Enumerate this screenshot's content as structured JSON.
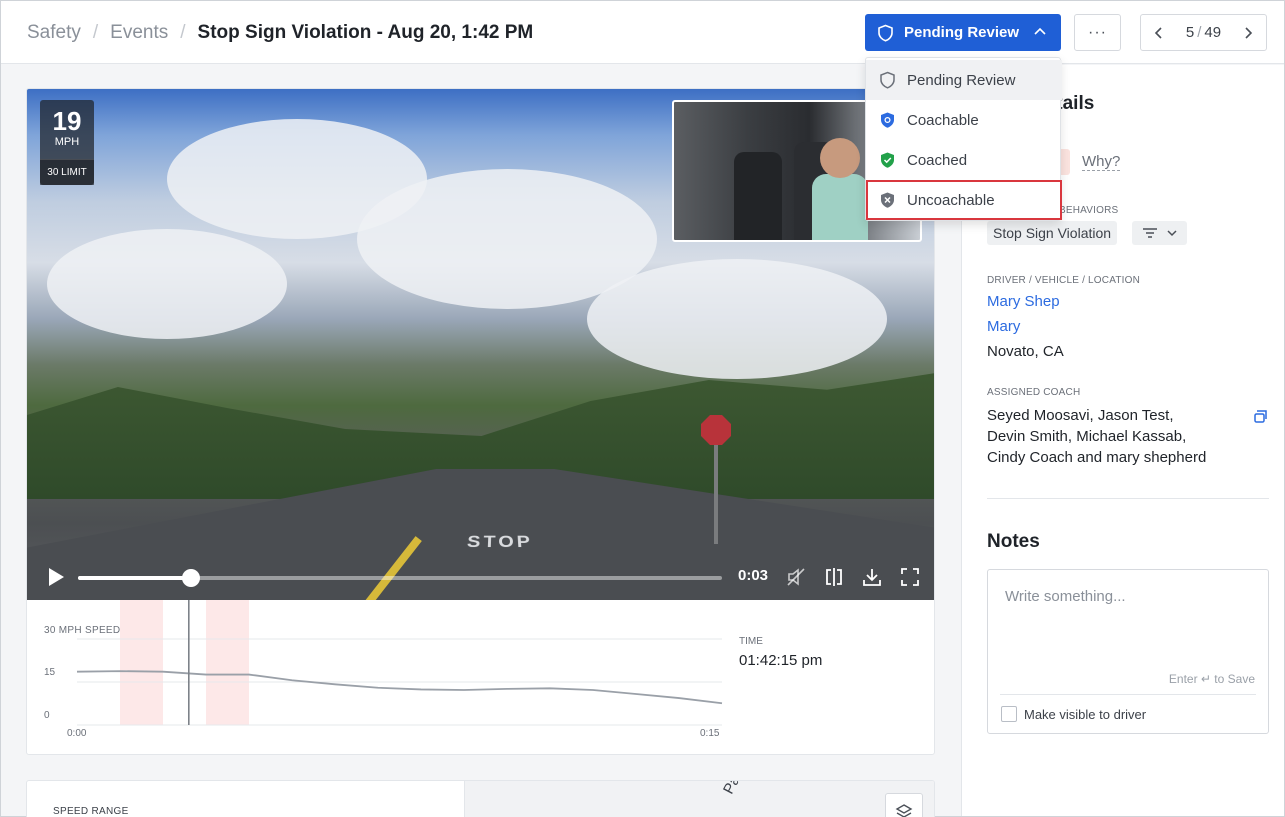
{
  "breadcrumb": {
    "items": [
      "Safety",
      "Events"
    ],
    "current": "Stop Sign Violation - Aug 20, 1:42 PM"
  },
  "status_button": {
    "label": "Pending Review"
  },
  "more_button": {
    "label": "···"
  },
  "pager": {
    "current": "5",
    "total": "49"
  },
  "video": {
    "speed": "19",
    "speed_unit": "MPH",
    "speed_limit": "30 LIMIT",
    "road_text": "STOP",
    "time": "0:03",
    "progress": 0.175
  },
  "speed_chart": {
    "title": "30 MPH SPEED",
    "time_label": "TIME",
    "time_value": "01:42:15 pm"
  },
  "chart_data": {
    "type": "line",
    "title": "30 MPH SPEED",
    "x": [
      0,
      1,
      2,
      3,
      4,
      5,
      6,
      7,
      8,
      9,
      10,
      11,
      12,
      13,
      14,
      15
    ],
    "values": [
      18.6,
      18.8,
      18.6,
      17.6,
      17.6,
      15.6,
      14.2,
      13.0,
      12.4,
      12.2,
      12.6,
      12.8,
      12.2,
      10.8,
      9.4,
      7.6
    ],
    "yticks": [
      "0",
      "15"
    ],
    "xticks": [
      "0:00",
      "0:15"
    ],
    "ylim": [
      0,
      30
    ],
    "xlim": [
      0,
      15
    ],
    "highlight_ranges": [
      [
        1.0,
        2.0
      ],
      [
        3.0,
        4.0
      ]
    ],
    "cursor_x": 2.6,
    "grid": true,
    "line_color": "#9aa0a8",
    "highlight_color": "#fde8e8"
  },
  "bottom_card": {
    "speed_range_label": "SPEED RANGE",
    "map_street": "Palme"
  },
  "side": {
    "details_title": "Details",
    "why_label": "Why?",
    "behaviors_label": "BEHAVIORS",
    "behavior_chip": "Stop Sign Violation",
    "dvl_label": "DRIVER / VEHICLE / LOCATION",
    "driver": "Mary Shep",
    "vehicle": "Mary",
    "location": "Novato, CA",
    "coach_label": "ASSIGNED COACH",
    "coach_lines": [
      "Seyed Moosavi, Jason Test,",
      "Devin Smith, Michael Kassab,",
      "Cindy Coach and mary shepherd"
    ],
    "notes_title": "Notes",
    "notes_placeholder": "Write something...",
    "enter_hint": "Enter ↵ to Save",
    "visible_label": "Make visible to driver"
  },
  "dropdown": {
    "items": [
      {
        "label": "Pending Review",
        "icon": "shield-outline-icon",
        "color": "#6b7079"
      },
      {
        "label": "Coachable",
        "icon": "shield-blue-icon",
        "color": "#2c6be0"
      },
      {
        "label": "Coached",
        "icon": "shield-check-icon",
        "color": "#22a14a"
      },
      {
        "label": "Uncoachable",
        "icon": "shield-x-icon",
        "color": "#6b7079"
      }
    ]
  },
  "colors": {
    "primary": "#1f5fd6",
    "link": "#2c6be0",
    "selected_outline": "#d9363e"
  }
}
